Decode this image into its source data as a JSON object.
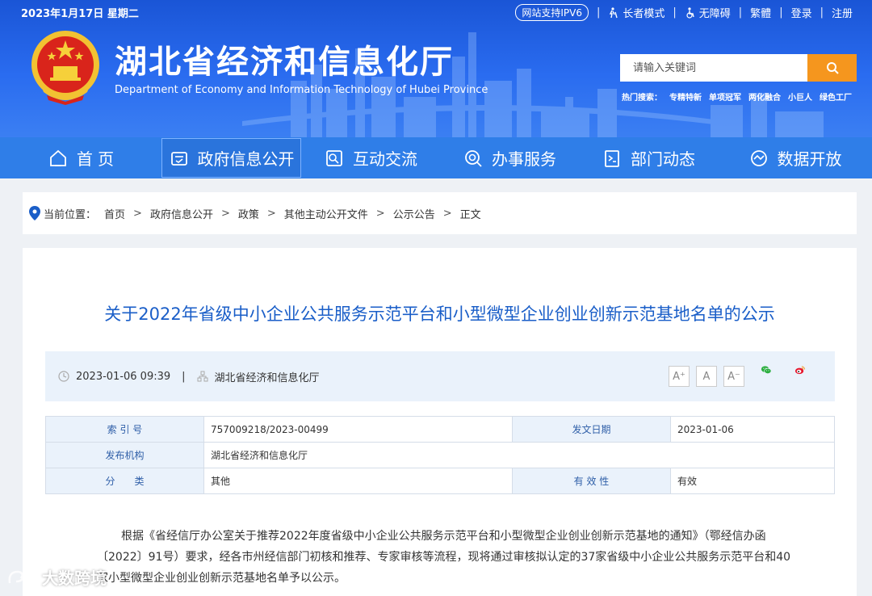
{
  "topbar": {
    "date": "2023年1月17日 星期二",
    "ipv6": "网站支持IPV6",
    "elder_mode": "长者模式",
    "accessibility": "无障碍",
    "traditional": "繁體",
    "login": "登录",
    "register": "注册"
  },
  "site": {
    "title": "湖北省经济和信息化厅",
    "subtitle": "Department of Economy and Information Technology of Hubei Province"
  },
  "search": {
    "placeholder": "请输入关键词",
    "hot_label": "热门搜索：",
    "hot_terms": [
      "专精特新",
      "单项冠军",
      "两化融合",
      "小巨人",
      "绿色工厂"
    ]
  },
  "nav": {
    "items": [
      {
        "label": "首 页"
      },
      {
        "label": "政府信息公开"
      },
      {
        "label": "互动交流"
      },
      {
        "label": "办事服务"
      },
      {
        "label": "部门动态"
      },
      {
        "label": "数据开放"
      }
    ]
  },
  "breadcrumb": {
    "label": "当前位置：",
    "items": [
      "首页",
      "政府信息公开",
      "政策",
      "其他主动公开文件",
      "公示公告",
      "正文"
    ],
    "separator": ">"
  },
  "article": {
    "title": "关于2022年省级中小企业公共服务示范平台和小型微型企业创业创新示范基地名单的公示",
    "datetime": "2023-01-06 09:39",
    "meta_sep": "|",
    "source": "湖北省经济和信息化厅",
    "font_sizes": [
      "A⁺",
      "A",
      "A⁻"
    ],
    "info": {
      "index_label": "索 引 号",
      "index_value": "757009218/2023-00499",
      "date_label": "发文日期",
      "date_value": "2023-01-06",
      "publisher_label": "发布机构",
      "publisher_value": "湖北省经济和信息化厅",
      "category_label": "分　　类",
      "category_value": "其他",
      "validity_label": "有 效 性",
      "validity_value": "有效"
    },
    "body": "根据《省经信厅办公室关于推荐2022年度省级中小企业公共服务示范平台和小型微型企业创业创新示范基地的通知》（鄂经信办函〔2022〕91号）要求，经各市州经信部门初核和推荐、专家审核等流程，现将通过审核拟认定的37家省级中小企业公共服务示范平台和40家小型微型企业创业创新示范基地名单予以公示。"
  },
  "watermark": "大数跨境",
  "colors": {
    "header_blue": "#2a6cf0",
    "nav_blue": "#2f7ee8",
    "title_blue": "#1a5ec8",
    "search_orange": "#f5961e",
    "meta_bg": "#eaf2fb"
  }
}
